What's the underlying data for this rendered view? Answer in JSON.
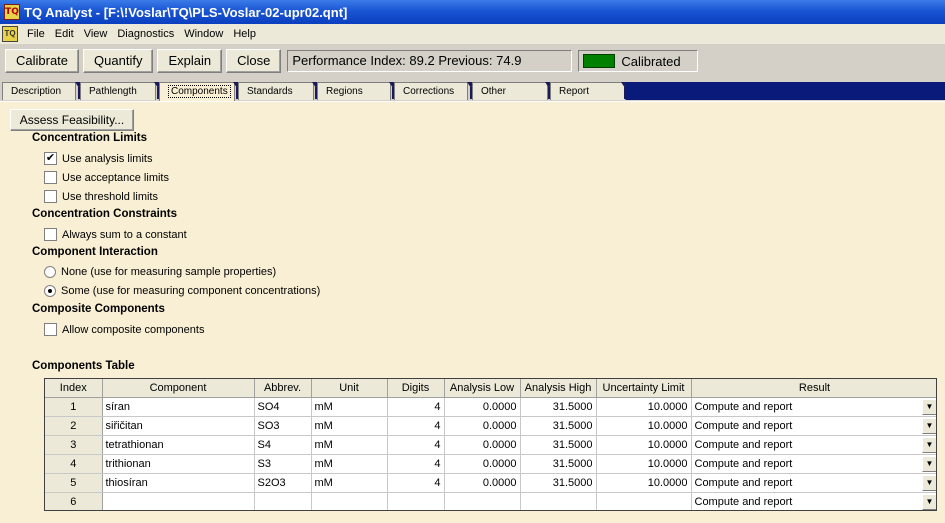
{
  "window": {
    "title": "TQ Analyst  - [F:\\!Voslar\\TQ\\PLS-Voslar-02-upr02.qnt]",
    "app_icon": "TQ",
    "menu_icon": "TQ"
  },
  "menu": [
    "File",
    "Edit",
    "View",
    "Diagnostics",
    "Window",
    "Help"
  ],
  "toolbar": {
    "calibrate": "Calibrate",
    "quantify": "Quantify",
    "explain": "Explain",
    "close": "Close",
    "performance": "Performance Index:  89.2  Previous:  74.9",
    "status": "Calibrated",
    "status_color": "#008000"
  },
  "tabs": [
    "Description",
    "Pathlength",
    "Components",
    "Standards",
    "Regions",
    "Corrections",
    "Other",
    "Report"
  ],
  "active_tab": "Components",
  "assess_button": "Assess Feasibility...",
  "sections": {
    "concentration_limits": "Concentration Limits",
    "concentration_constraints": "Concentration Constraints",
    "component_interaction": "Component Interaction",
    "composite_components": "Composite Components",
    "components_table": "Components Table"
  },
  "options": {
    "use_analysis_limits": {
      "label": "Use analysis limits",
      "checked": true
    },
    "use_acceptance_limits": {
      "label": "Use acceptance limits",
      "checked": false
    },
    "use_threshold_limits": {
      "label": "Use threshold limits",
      "checked": false
    },
    "always_sum": {
      "label": "Always sum to a constant",
      "checked": false
    },
    "interaction_none": {
      "label": "None (use for measuring sample properties)",
      "selected": false
    },
    "interaction_some": {
      "label": "Some (use for measuring component concentrations)",
      "selected": true
    },
    "allow_composite": {
      "label": "Allow composite components",
      "checked": false
    }
  },
  "table": {
    "headers": [
      "Index",
      "Component",
      "Abbrev.",
      "Unit",
      "Digits",
      "Analysis Low",
      "Analysis High",
      "Uncertainty Limit",
      "Result"
    ],
    "rows": [
      [
        "1",
        "síran",
        "SO4",
        "mM",
        "4",
        "0.0000",
        "31.5000",
        "10.0000",
        "Compute and report"
      ],
      [
        "2",
        "siřičitan",
        "SO3",
        "mM",
        "4",
        "0.0000",
        "31.5000",
        "10.0000",
        "Compute and report"
      ],
      [
        "3",
        "tetrathionan",
        "S4",
        "mM",
        "4",
        "0.0000",
        "31.5000",
        "10.0000",
        "Compute and report"
      ],
      [
        "4",
        "trithionan",
        "S3",
        "mM",
        "4",
        "0.0000",
        "31.5000",
        "10.0000",
        "Compute and report"
      ],
      [
        "5",
        "thiosíran",
        "S2O3",
        "mM",
        "4",
        "0.0000",
        "31.5000",
        "10.0000",
        "Compute and report"
      ],
      [
        "6",
        "",
        "",
        "",
        "",
        "",
        "",
        "",
        "Compute and report"
      ]
    ]
  }
}
